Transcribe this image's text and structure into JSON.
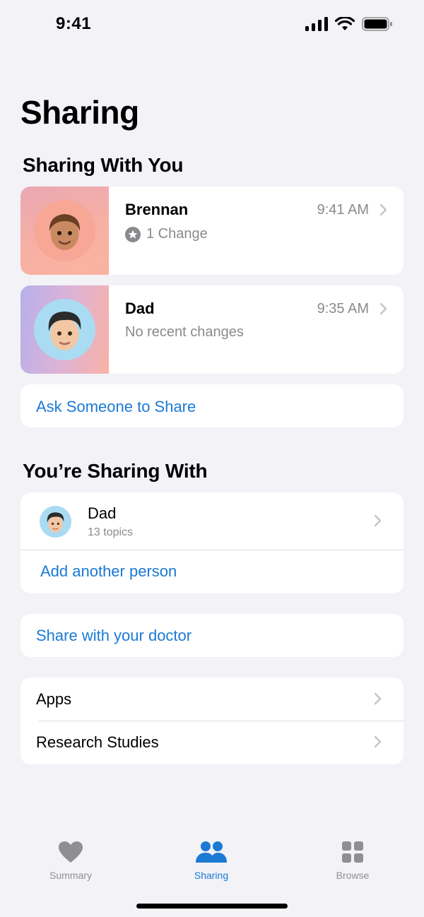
{
  "status_bar": {
    "time": "9:41",
    "icons": [
      "cellular-signal-icon",
      "wifi-icon",
      "battery-icon"
    ]
  },
  "page_title": "Sharing",
  "sharing_with_you": {
    "title": "Sharing With You",
    "people": [
      {
        "name": "Brennan",
        "time": "9:41 AM",
        "detail": "1 Change",
        "detail_icon": "star-badge-icon"
      },
      {
        "name": "Dad",
        "time": "9:35 AM",
        "detail": "No recent changes"
      }
    ],
    "ask_label": "Ask Someone to Share"
  },
  "youre_sharing_with": {
    "title": "You’re Sharing With",
    "person": {
      "name": "Dad",
      "subtitle": "13 topics"
    },
    "add_label": "Add another person"
  },
  "doctor_label": "Share with your doctor",
  "more": {
    "items": [
      "Apps",
      "Research Studies"
    ]
  },
  "tab_bar": {
    "tabs": [
      {
        "label": "Summary",
        "icon": "heart-icon"
      },
      {
        "label": "Sharing",
        "icon": "people-icon"
      },
      {
        "label": "Browse",
        "icon": "grid-icon"
      }
    ],
    "active": "Sharing"
  },
  "colors": {
    "accent": "#1a7ad4",
    "secondary_text": "#8a8a8e",
    "background": "#f2f2f7"
  }
}
